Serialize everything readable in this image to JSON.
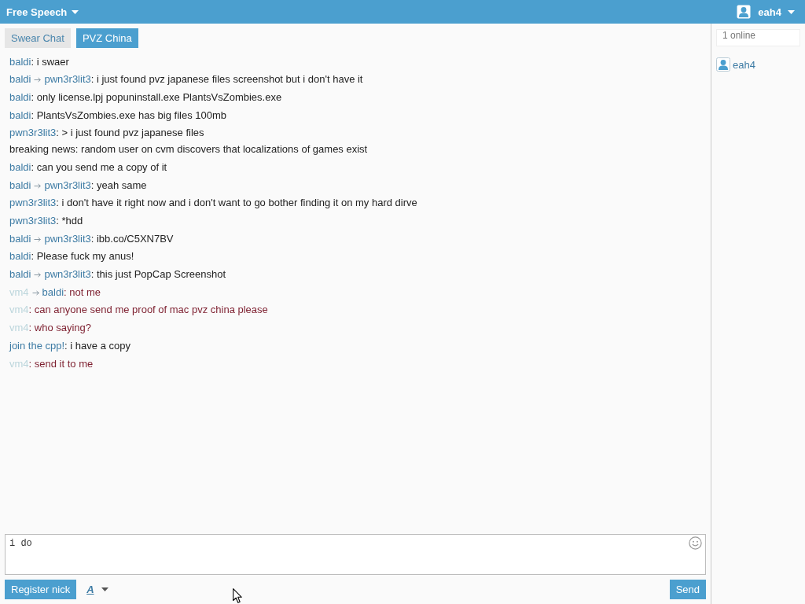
{
  "top_bar": {
    "room_menu": "Free Speech",
    "user_menu": "eah4"
  },
  "tabs": [
    {
      "label": "Swear Chat",
      "selected": false
    },
    {
      "label": "PVZ China",
      "selected": true
    }
  ],
  "messages": [
    {
      "author": "baldi",
      "author_dimmed": false,
      "text": ": i swaer",
      "color": "#222222"
    },
    {
      "author": "baldi",
      "author_dimmed": false,
      "recipient": "pwn3r3lit3",
      "text": ": i just found pvz japanese files screenshot but i don't have it",
      "color": "#222222"
    },
    {
      "author": "baldi",
      "author_dimmed": false,
      "text": ": only license.lpj popuninstall.exe PlantsVsZombies.exe",
      "color": "#222222"
    },
    {
      "author": "baldi",
      "author_dimmed": false,
      "text": ": PlantsVsZombies.exe has big files 100mb",
      "color": "#222222"
    },
    {
      "author": "pwn3r3lit3",
      "author_dimmed": false,
      "text": ": > i just found pvz japanese files\nbreaking news: random user on cvm discovers that localizations of games exist",
      "color": "#222222"
    },
    {
      "author": "baldi",
      "author_dimmed": false,
      "text": ": can you send me a copy of it",
      "color": "#222222"
    },
    {
      "author": "baldi",
      "author_dimmed": false,
      "recipient": "pwn3r3lit3",
      "text": ": yeah same",
      "color": "#222222"
    },
    {
      "author": "pwn3r3lit3",
      "author_dimmed": false,
      "text": ": i don't have it right now and i don't want to go bother finding it on my hard dirve",
      "color": "#222222"
    },
    {
      "author": "pwn3r3lit3",
      "author_dimmed": false,
      "text": ": *hdd",
      "color": "#222222"
    },
    {
      "author": "baldi",
      "author_dimmed": false,
      "recipient": "pwn3r3lit3",
      "text": ": ibb.co/C5XN7BV",
      "color": "#222222"
    },
    {
      "author": "baldi",
      "author_dimmed": false,
      "text": ": Please fuck my anus!",
      "color": "#222222"
    },
    {
      "author": "baldi",
      "author_dimmed": false,
      "recipient": "pwn3r3lit3",
      "text": ": this just PopCap Screenshot",
      "color": "#222222"
    },
    {
      "author": "vm4",
      "author_dimmed": true,
      "recipient": "baldi",
      "text": ": not me",
      "color": "#7d1f2f"
    },
    {
      "author": "vm4",
      "author_dimmed": true,
      "text": ": can anyone send me proof of mac pvz china please",
      "color": "#7d1f2f"
    },
    {
      "author": "vm4",
      "author_dimmed": true,
      "text": ": who saying?",
      "color": "#7d1f2f"
    },
    {
      "author": "join the cpp!",
      "author_dimmed": false,
      "text": ": i have a copy",
      "color": "#222222"
    },
    {
      "author": "vm4",
      "author_dimmed": true,
      "text": ": send it to me",
      "color": "#7d1f2f"
    }
  ],
  "composer": {
    "value": "i do",
    "register_button": "Register nick",
    "font_button": "A",
    "send_button": "Send"
  },
  "sidebar": {
    "online_count": "1 online",
    "users": [
      {
        "name": "eah4"
      }
    ]
  }
}
